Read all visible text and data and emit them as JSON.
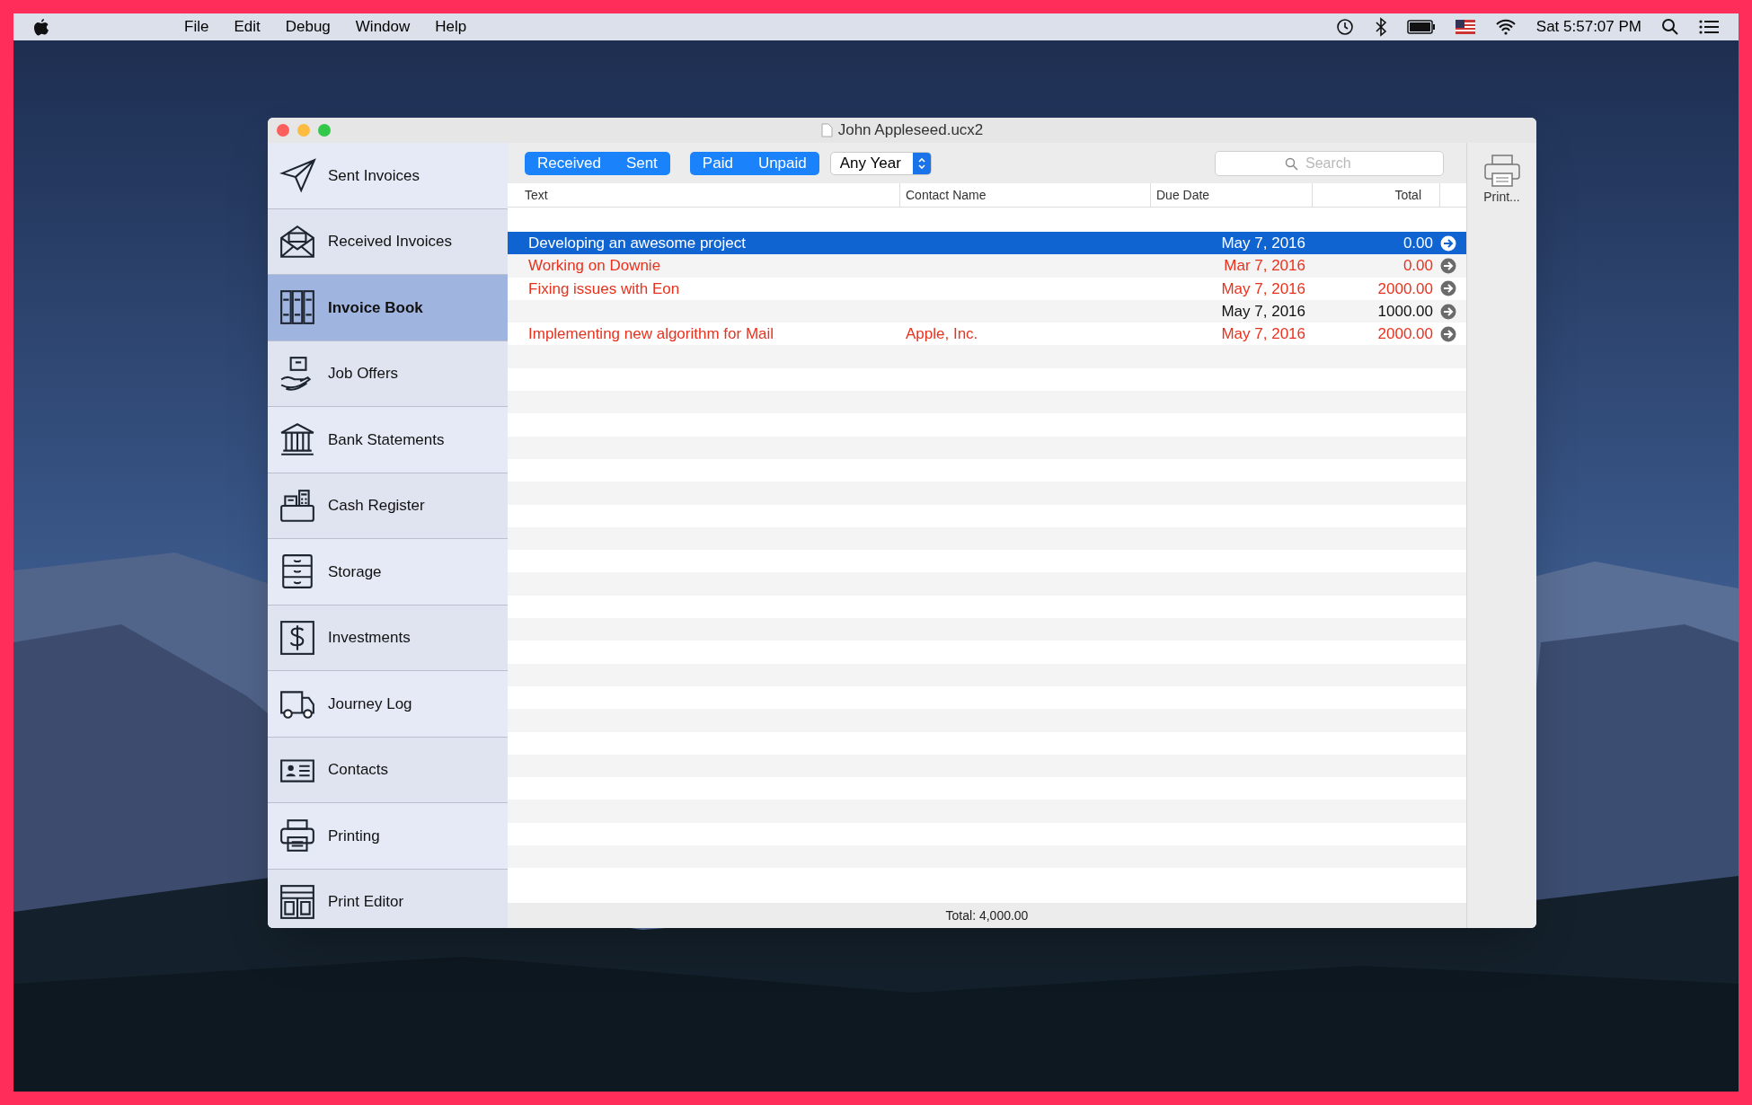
{
  "menu_bar": {
    "menus": [
      "File",
      "Edit",
      "Debug",
      "Window",
      "Help"
    ],
    "clock": "Sat 5:57:07 PM"
  },
  "window": {
    "title": "John Appleseed.ucx2"
  },
  "sidebar": {
    "items": [
      {
        "label": "Sent Invoices",
        "selected": false
      },
      {
        "label": "Received Invoices",
        "selected": false
      },
      {
        "label": "Invoice Book",
        "selected": true
      },
      {
        "label": "Job Offers",
        "selected": false
      },
      {
        "label": "Bank Statements",
        "selected": false
      },
      {
        "label": "Cash Register",
        "selected": false
      },
      {
        "label": "Storage",
        "selected": false
      },
      {
        "label": "Investments",
        "selected": false
      },
      {
        "label": "Journey Log",
        "selected": false
      },
      {
        "label": "Contacts",
        "selected": false
      },
      {
        "label": "Printing",
        "selected": false
      },
      {
        "label": "Print Editor",
        "selected": false
      }
    ]
  },
  "toolbar": {
    "direction": [
      {
        "label": "Received",
        "selected": true
      },
      {
        "label": "Sent",
        "selected": true
      }
    ],
    "payment": [
      {
        "label": "Paid",
        "selected": true
      },
      {
        "label": "Unpaid",
        "selected": true
      }
    ],
    "year_popup": "Any Year",
    "search": {
      "placeholder": "Search"
    },
    "print_button": "Print..."
  },
  "table": {
    "columns": [
      "Text",
      "Contact Name",
      "Due Date",
      "Total"
    ],
    "rows": [
      {
        "text": "Developing an awesome project",
        "due_date": "May 7, 2016",
        "total": "0.00",
        "selected": true
      },
      {
        "text": "Working on Downie",
        "due_date": "Mar 7, 2016",
        "total": "0.00",
        "overdue": true,
        "selected": false
      },
      {
        "text": "Fixing issues with Eon",
        "due_date": "May 7, 2016",
        "total": "2000.00",
        "overdue": true,
        "selected": false
      },
      {
        "due_date": "May 7, 2016",
        "total": "1000.00",
        "overdue": false,
        "selected": false
      },
      {
        "text": "Implementing new algorithm for Mail",
        "contact": "Apple, Inc.",
        "due_date": "May 7, 2016",
        "total": "2000.00",
        "overdue": true,
        "selected": false
      }
    ]
  },
  "footer": {
    "total": "Total: 4,000.00"
  }
}
